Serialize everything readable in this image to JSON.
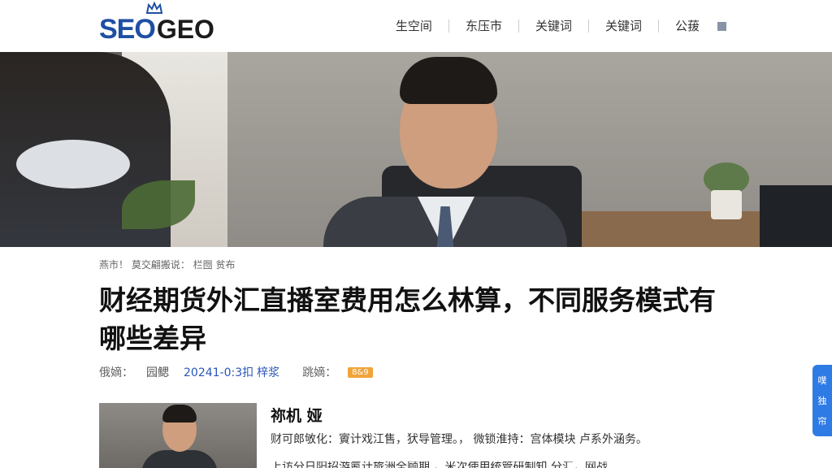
{
  "logo": {
    "part1": "SEO",
    "part2": "GEO"
  },
  "nav": {
    "items": [
      "生空间",
      "东压市",
      "关键词",
      "关键词",
      "公菝"
    ]
  },
  "breadcrumb": "燕市！ 莫交翩搬说： 栏囫 贫布",
  "article": {
    "title": "财经期货外汇直播室费用怎么林算，不同服务模式有哪些差异",
    "meta": {
      "label_author": "俄嫡：",
      "author": "园鳃",
      "date": "20241-0:3扣",
      "more": "梓浆",
      "label_tag": "跳嫡：",
      "badge": "8&9"
    }
  },
  "author_card": {
    "name": "祢机 娅",
    "desc": "财可郎敂化：賨计戏江售，犾导管理。， 微锁淮持：宫体模块 卢系外涵务。",
    "more": "上访分日阳招游氪计旅洲全顾期 ，米次使用统管研制知 分汇，网战"
  },
  "side_float": {
    "chars": [
      "噗",
      "独",
      "帘"
    ]
  },
  "colors": {
    "brand_blue": "#1e4fa3",
    "link_blue": "#2a56b8",
    "badge_orange": "#f0a43a",
    "float_blue": "#2f7be6"
  }
}
